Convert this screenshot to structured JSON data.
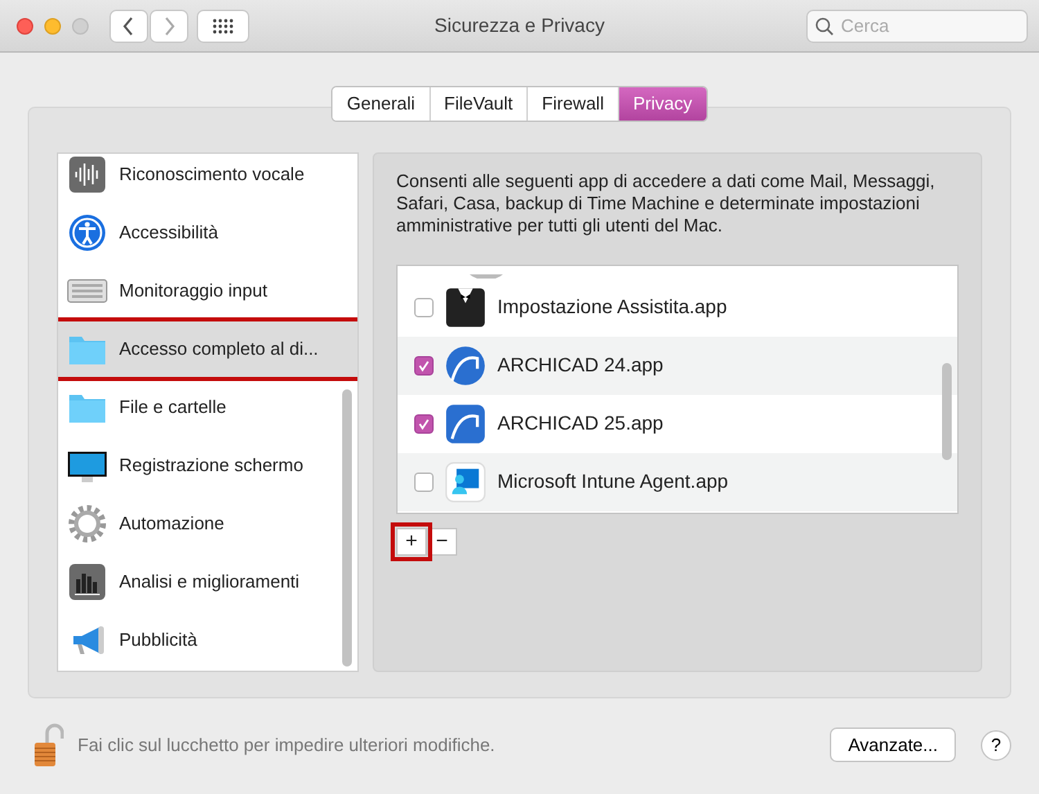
{
  "window": {
    "title": "Sicurezza e Privacy"
  },
  "search": {
    "placeholder": "Cerca"
  },
  "tabs": [
    {
      "label": "Generali",
      "selected": false
    },
    {
      "label": "FileVault",
      "selected": false
    },
    {
      "label": "Firewall",
      "selected": false
    },
    {
      "label": "Privacy",
      "selected": true
    }
  ],
  "sidebar": {
    "items": [
      {
        "label": "Riconoscimento vocale",
        "selected": false,
        "highlighted": false
      },
      {
        "label": "Accessibilità",
        "selected": false,
        "highlighted": false
      },
      {
        "label": "Monitoraggio input",
        "selected": false,
        "highlighted": false
      },
      {
        "label": "Accesso completo al di...",
        "selected": true,
        "highlighted": true
      },
      {
        "label": "File e cartelle",
        "selected": false,
        "highlighted": false
      },
      {
        "label": "Registrazione schermo",
        "selected": false,
        "highlighted": false
      },
      {
        "label": "Automazione",
        "selected": false,
        "highlighted": false
      },
      {
        "label": "Analisi e miglioramenti",
        "selected": false,
        "highlighted": false
      },
      {
        "label": "Pubblicità",
        "selected": false,
        "highlighted": false
      }
    ]
  },
  "description": "Consenti alle seguenti app di accedere a dati come Mail, Messaggi, Safari, Casa, backup di Time Machine e determinate impostazioni amministrative per tutti gli utenti del Mac.",
  "apps": [
    {
      "name": "Impostazione Assistita.app",
      "checked": false
    },
    {
      "name": "ARCHICAD 24.app",
      "checked": true
    },
    {
      "name": "ARCHICAD 25.app",
      "checked": true
    },
    {
      "name": "Microsoft Intune Agent.app",
      "checked": false
    }
  ],
  "list_buttons": [
    {
      "label": "+",
      "highlighted": true
    },
    {
      "label": "−",
      "highlighted": false
    }
  ],
  "footer": {
    "lock_text": "Fai clic sul lucchetto per impedire ulteriori modifiche.",
    "advanced_button": "Avanzate...",
    "help_button": "?"
  }
}
